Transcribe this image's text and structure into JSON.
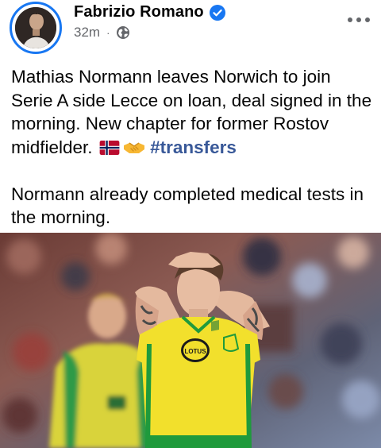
{
  "post": {
    "author": {
      "name": "Fabrizio Romano",
      "verified": true,
      "avatar": "avatar"
    },
    "meta": {
      "time": "32m",
      "separator": "·",
      "privacy_icon": "globe-icon"
    },
    "menu_icon": "more-options-icon",
    "text": {
      "para1_main": "Mathias Normann leaves Norwich to join Serie A side Lecce on loan, deal signed in the morning. New chapter for former Rostov midfielder.",
      "emoji_1": "norway-flag-icon",
      "emoji_2": "handshake-icon",
      "hashtag": "#transfers",
      "para2": "Normann already completed medical tests in the morning."
    },
    "photo": {
      "subject": "Norwich player in yellow kit with hands on head",
      "shirt_badge": "LOTUS"
    }
  },
  "colors": {
    "verified": "#1877f2",
    "hashtag": "#385898",
    "meta_text": "#65676b",
    "kit_yellow": "#f5e12a",
    "kit_green": "#1f9a3c"
  }
}
